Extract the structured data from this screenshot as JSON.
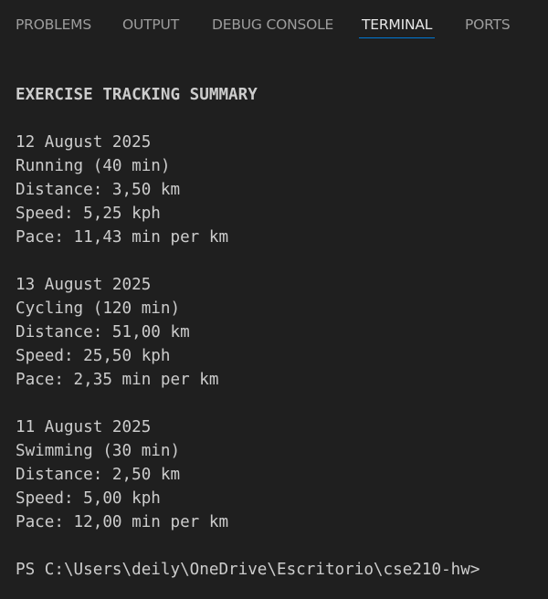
{
  "panel": {
    "tabs": [
      {
        "label": "PROBLEMS",
        "active": false
      },
      {
        "label": "OUTPUT",
        "active": false
      },
      {
        "label": "DEBUG CONSOLE",
        "active": false
      },
      {
        "label": "TERMINAL",
        "active": true
      },
      {
        "label": "PORTS",
        "active": false
      }
    ],
    "accent_color": "#0078d4"
  },
  "terminal": {
    "lines": [
      "EXERCISE TRACKING SUMMARY",
      "",
      "12 August 2025",
      "Running (40 min)",
      "Distance: 3,50 km",
      "Speed: 5,25 kph",
      "Pace: 11,43 min per km",
      "",
      "13 August 2025",
      "Cycling (120 min)",
      "Distance: 51,00 km",
      "Speed: 25,50 kph",
      "Pace: 2,35 min per km",
      "",
      "11 August 2025",
      "Swimming (30 min)",
      "Distance: 2,50 km",
      "Speed: 5,00 kph",
      "Pace: 12,00 min per km",
      "",
      "PS C:\\Users\\deily\\OneDrive\\Escritorio\\cse210-hw>"
    ]
  }
}
